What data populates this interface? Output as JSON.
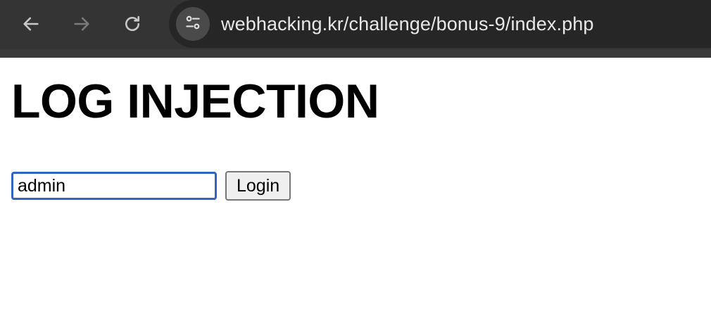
{
  "browser": {
    "url": "webhacking.kr/challenge/bonus-9/index.php",
    "icons": {
      "back": "arrow-left-icon",
      "forward": "arrow-right-icon",
      "reload": "reload-icon",
      "site_info": "tune-icon"
    },
    "colors": {
      "toolbar": "#343434",
      "omnibox": "#262626",
      "url_text": "#e8e8e8"
    }
  },
  "page": {
    "title": "LOG INJECTION",
    "form": {
      "id_value": "admin",
      "login_label": "Login"
    },
    "colors": {
      "input_focus_border": "#2f64c0"
    }
  }
}
